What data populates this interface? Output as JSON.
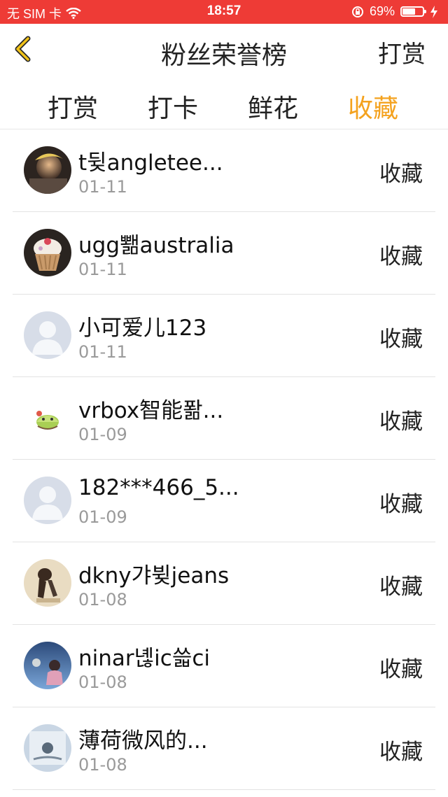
{
  "status_bar": {
    "carrier": "无 SIM 卡",
    "time": "18:57",
    "battery": "69%",
    "battery_level": 0.69
  },
  "nav": {
    "title": "粉丝荣誉榜",
    "right_button": "打赏"
  },
  "tabs": [
    {
      "label": "打赏",
      "active": false
    },
    {
      "label": "打卡",
      "active": false
    },
    {
      "label": "鲜花",
      "active": false
    },
    {
      "label": "收藏",
      "active": true
    }
  ],
  "colors": {
    "status_bar": "#ee3b36",
    "active_tab": "#f4a21e"
  },
  "list": [
    {
      "name": "t뒺angletee...",
      "date": "01-11",
      "action": "收藏",
      "avatar": "photo-avatar-person"
    },
    {
      "name": "ugg뾂australia",
      "date": "01-11",
      "action": "收藏",
      "avatar": "cupcake-avatar"
    },
    {
      "name": "小可爱儿123",
      "date": "01-11",
      "action": "收藏",
      "avatar": "default-avatar"
    },
    {
      "name": "vrbox智能퐒...",
      "date": "01-09",
      "action": "收藏",
      "avatar": "cartoon-avatar"
    },
    {
      "name": "182***466_5...",
      "date": "01-09",
      "action": "收藏",
      "avatar": "default-avatar"
    },
    {
      "name": "dkny갸뷪jeans",
      "date": "01-08",
      "action": "收藏",
      "avatar": "dog-avatar"
    },
    {
      "name": "ninar녢ic쓻ci",
      "date": "01-08",
      "action": "收藏",
      "avatar": "photo-avatar-girl"
    },
    {
      "name": "薄荷微风的...",
      "date": "01-08",
      "action": "收藏",
      "avatar": "photo-avatar-blue"
    }
  ]
}
